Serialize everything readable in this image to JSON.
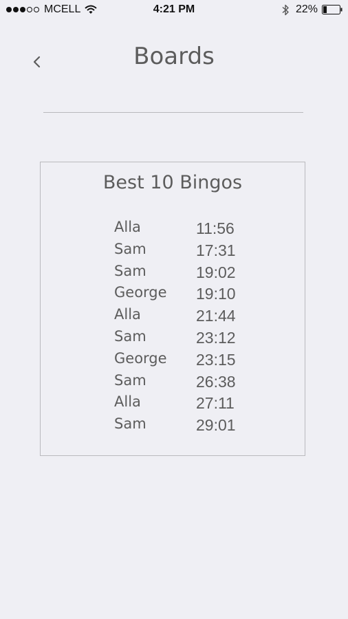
{
  "status_bar": {
    "carrier": "MCELL",
    "time": "4:21 PM",
    "battery_percent": "22%",
    "signal_bars_filled": 3,
    "signal_bars_total": 5,
    "battery_level": 0.22
  },
  "nav": {
    "title": "Boards",
    "back_icon": "chevron-left-icon"
  },
  "board": {
    "heading": "Best 10 Bingos",
    "scores": [
      {
        "name": "Alla",
        "time": "11:56"
      },
      {
        "name": "Sam",
        "time": "17:31"
      },
      {
        "name": "Sam",
        "time": "19:02"
      },
      {
        "name": "George",
        "time": "19:10"
      },
      {
        "name": "Alla",
        "time": "21:44"
      },
      {
        "name": "Sam",
        "time": "23:12"
      },
      {
        "name": "George",
        "time": "23:15"
      },
      {
        "name": "Sam",
        "time": "26:38"
      },
      {
        "name": "Alla",
        "time": "27:11"
      },
      {
        "name": "Sam",
        "time": "29:01"
      }
    ]
  },
  "colors": {
    "background": "#efeff4",
    "text": "#5c5c5c",
    "border": "#b9b9bd"
  }
}
